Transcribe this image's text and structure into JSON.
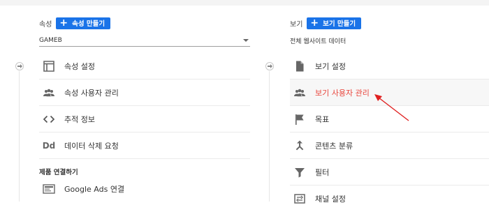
{
  "property": {
    "header_label": "속성",
    "create_button": "속성 만들기",
    "selected": "GAMEB",
    "items": [
      {
        "label": "속성 설정",
        "icon": "page-layout-icon"
      },
      {
        "label": "속성 사용자 관리",
        "icon": "people-icon"
      },
      {
        "label": "추적 정보",
        "icon": "code-icon"
      },
      {
        "label": "데이터 삭제 요청",
        "icon": "dd-icon",
        "icon_text": "Dd"
      }
    ],
    "section_title": "제품 연결하기",
    "linked_items": [
      {
        "label": "Google Ads 연결",
        "icon": "google-ads-icon"
      }
    ]
  },
  "view": {
    "header_label": "보기",
    "create_button": "보기 만들기",
    "selected": "전체 웹사이트 데이터",
    "items": [
      {
        "label": "보기 설정",
        "icon": "document-icon"
      },
      {
        "label": "보기 사용자 관리",
        "icon": "people-icon",
        "active": true
      },
      {
        "label": "목표",
        "icon": "flag-icon"
      },
      {
        "label": "콘텐츠 분류",
        "icon": "merge-icon"
      },
      {
        "label": "필터",
        "icon": "filter-icon"
      },
      {
        "label": "채널 설정",
        "icon": "channel-icon"
      }
    ]
  },
  "colors": {
    "accent": "#1a73e8",
    "highlight_text": "#e8453c",
    "annotation_arrow": "#e02020"
  }
}
